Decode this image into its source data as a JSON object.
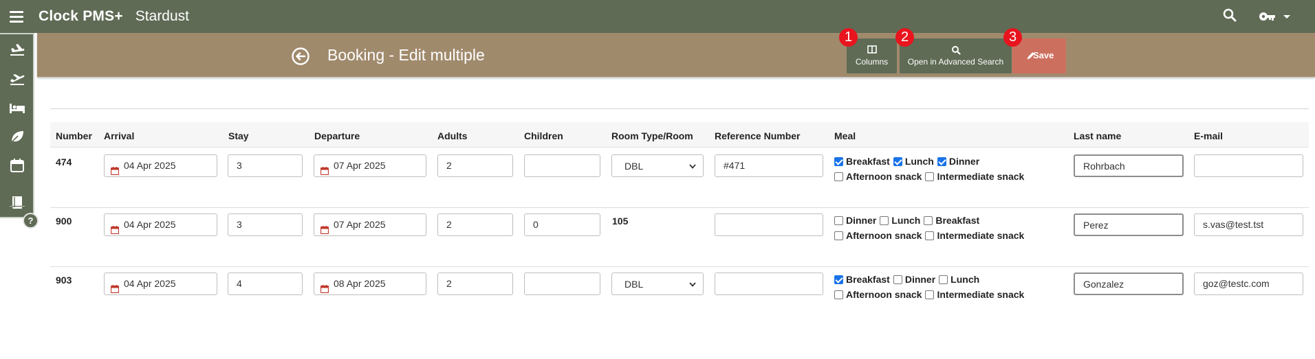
{
  "app": {
    "title": "Clock PMS+",
    "hotel": "Stardust"
  },
  "page": {
    "title": "Booking - Edit multiple"
  },
  "toolbar": {
    "columns_label": "Columns",
    "advanced_search_label": "Open in Advanced Search",
    "save_label": "Save",
    "badges": [
      "1",
      "2",
      "3"
    ]
  },
  "help": "?",
  "columns": [
    "Number",
    "Arrival",
    "Stay",
    "Departure",
    "Adults",
    "Children",
    "Room Type/Room",
    "Reference Number",
    "Meal",
    "Last name",
    "E-mail"
  ],
  "rows": [
    {
      "number": "474",
      "arrival": "04 Apr 2025",
      "stay": "3",
      "departure": "07 Apr 2025",
      "adults": "2",
      "children": "",
      "room": "DBL",
      "room_is_select": true,
      "reference": "#471",
      "meals_line1": [
        {
          "label": "Breakfast",
          "checked": true
        },
        {
          "label": "Lunch",
          "checked": true
        },
        {
          "label": "Dinner",
          "checked": true
        }
      ],
      "meals_line2": [
        {
          "label": "Afternoon snack",
          "checked": false
        },
        {
          "label": "Intermediate snack",
          "checked": false
        }
      ],
      "last_name": "Rohrbach",
      "email": ""
    },
    {
      "number": "900",
      "arrival": "04 Apr 2025",
      "stay": "3",
      "departure": "07 Apr 2025",
      "adults": "2",
      "children": "0",
      "room": "105",
      "room_is_select": false,
      "reference": "",
      "meals_line1": [
        {
          "label": "Dinner",
          "checked": false
        },
        {
          "label": "Lunch",
          "checked": false
        },
        {
          "label": "Breakfast",
          "checked": false
        }
      ],
      "meals_line2": [
        {
          "label": "Afternoon snack",
          "checked": false
        },
        {
          "label": "Intermediate snack",
          "checked": false
        }
      ],
      "last_name": "Perez",
      "email": "s.vas@test.tst"
    },
    {
      "number": "903",
      "arrival": "04 Apr 2025",
      "stay": "4",
      "departure": "08 Apr 2025",
      "adults": "2",
      "children": "",
      "room": "DBL",
      "room_is_select": true,
      "reference": "",
      "meals_line1": [
        {
          "label": "Breakfast",
          "checked": true
        },
        {
          "label": "Dinner",
          "checked": false
        },
        {
          "label": "Lunch",
          "checked": false
        }
      ],
      "meals_line2": [
        {
          "label": "Afternoon snack",
          "checked": false
        },
        {
          "label": "Intermediate snack",
          "checked": false
        }
      ],
      "last_name": "Gonzalez",
      "email": "goz@testc.com"
    }
  ]
}
